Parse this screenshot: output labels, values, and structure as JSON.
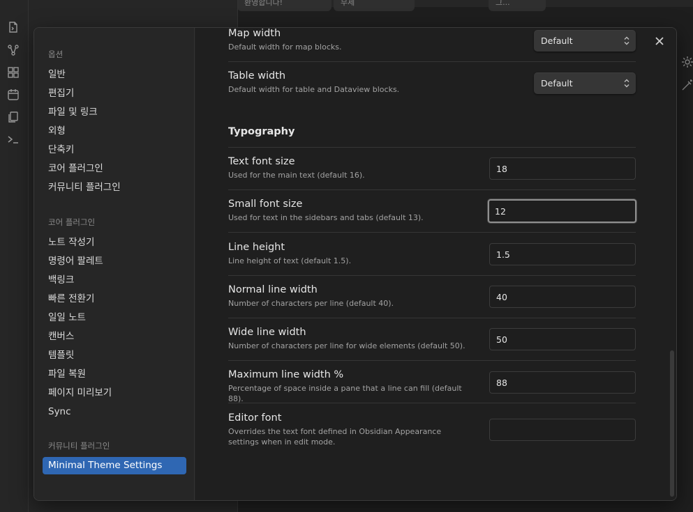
{
  "background": {
    "tabs": [
      "환영합니다!",
      "무제",
      "그..."
    ]
  },
  "nav": {
    "groups": [
      {
        "heading": "옵션",
        "items": [
          "일반",
          "편집기",
          "파일 및 링크",
          "외형",
          "단축키",
          "코어 플러그인",
          "커뮤니티 플러그인"
        ]
      },
      {
        "heading": "코어 플러그인",
        "items": [
          "노트 작성기",
          "명령어 팔레트",
          "백링크",
          "빠른 전환기",
          "일일 노트",
          "캔버스",
          "템플릿",
          "파일 복원",
          "페이지 미리보기",
          "Sync"
        ]
      },
      {
        "heading": "커뮤니티 플러그인",
        "items": [
          "Minimal Theme Settings"
        ]
      }
    ]
  },
  "settings": {
    "map_width": {
      "name": "Map width",
      "desc": "Default width for map blocks.",
      "value": "Default"
    },
    "table_width": {
      "name": "Table width",
      "desc": "Default width for table and Dataview blocks.",
      "value": "Default"
    },
    "typography_title": "Typography",
    "text_font_size": {
      "name": "Text font size",
      "desc": "Used for the main text (default 16).",
      "value": "18"
    },
    "small_font_size": {
      "name": "Small font size",
      "desc": "Used for text in the sidebars and tabs (default 13).",
      "value": "12"
    },
    "line_height": {
      "name": "Line height",
      "desc": "Line height of text (default 1.5).",
      "value": "1.5"
    },
    "normal_line_width": {
      "name": "Normal line width",
      "desc": "Number of characters per line (default 40).",
      "value": "40"
    },
    "wide_line_width": {
      "name": "Wide line width",
      "desc": "Number of characters per line for wide elements (default 50).",
      "value": "50"
    },
    "max_line_width": {
      "name": "Maximum line width %",
      "desc": "Percentage of space inside a pane that a line can fill (default 88).",
      "value": "88"
    },
    "editor_font": {
      "name": "Editor font",
      "desc": "Overrides the text font defined in Obsidian Appearance settings when in edit mode.",
      "value": ""
    }
  },
  "colors": {
    "accent": "#2f67b3",
    "background": "#1f1f1f",
    "sidebar": "#262626"
  }
}
